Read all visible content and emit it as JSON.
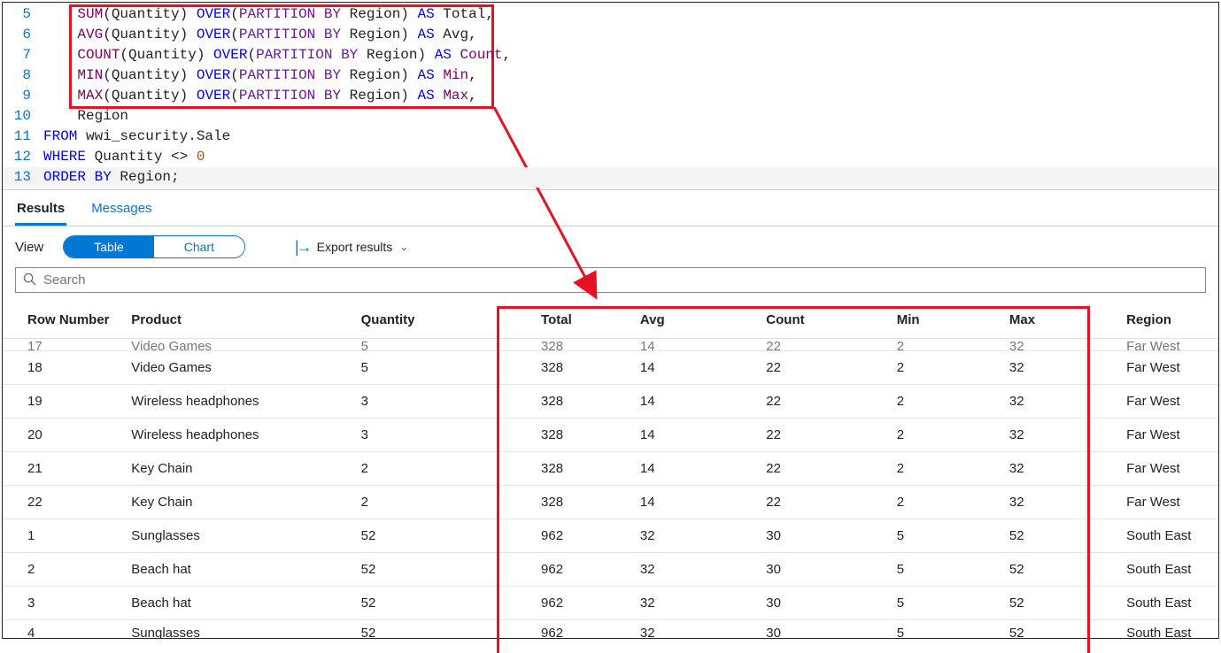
{
  "editor": {
    "lines": [
      {
        "n": 5,
        "tokens": [
          [
            "fn",
            "SUM"
          ],
          [
            "id",
            "(Quantity) "
          ],
          [
            "kw",
            "OVER"
          ],
          [
            "id",
            "("
          ],
          [
            "pkw",
            "PARTITION BY"
          ],
          [
            "id",
            " Region) "
          ],
          [
            "kw",
            "AS"
          ],
          [
            "id",
            " Total,"
          ]
        ]
      },
      {
        "n": 6,
        "tokens": [
          [
            "fn",
            "AVG"
          ],
          [
            "id",
            "(Quantity) "
          ],
          [
            "kw",
            "OVER"
          ],
          [
            "id",
            "("
          ],
          [
            "pkw",
            "PARTITION BY"
          ],
          [
            "id",
            " Region) "
          ],
          [
            "kw",
            "AS"
          ],
          [
            "id",
            " Avg,"
          ]
        ]
      },
      {
        "n": 7,
        "tokens": [
          [
            "fn",
            "COUNT"
          ],
          [
            "id",
            "(Quantity) "
          ],
          [
            "kw",
            "OVER"
          ],
          [
            "id",
            "("
          ],
          [
            "pkw",
            "PARTITION BY"
          ],
          [
            "id",
            " Region) "
          ],
          [
            "kw",
            "AS"
          ],
          [
            "id",
            " "
          ],
          [
            "fn",
            "Count"
          ],
          [
            "id",
            ","
          ]
        ]
      },
      {
        "n": 8,
        "tokens": [
          [
            "fn",
            "MIN"
          ],
          [
            "id",
            "(Quantity) "
          ],
          [
            "kw",
            "OVER"
          ],
          [
            "id",
            "("
          ],
          [
            "pkw",
            "PARTITION BY"
          ],
          [
            "id",
            " Region) "
          ],
          [
            "kw",
            "AS"
          ],
          [
            "id",
            " "
          ],
          [
            "fn",
            "Min"
          ],
          [
            "id",
            ","
          ]
        ]
      },
      {
        "n": 9,
        "tokens": [
          [
            "fn",
            "MAX"
          ],
          [
            "id",
            "(Quantity) "
          ],
          [
            "kw",
            "OVER"
          ],
          [
            "id",
            "("
          ],
          [
            "pkw",
            "PARTITION BY"
          ],
          [
            "id",
            " Region) "
          ],
          [
            "kw",
            "AS"
          ],
          [
            "id",
            " "
          ],
          [
            "fn",
            "Max"
          ],
          [
            "id",
            ","
          ]
        ]
      },
      {
        "n": 10,
        "tokens": [
          [
            "id",
            "Region"
          ]
        ]
      },
      {
        "n": 11,
        "tokens": [
          [
            "kw",
            "FROM"
          ],
          [
            "id",
            " wwi_security.Sale"
          ]
        ]
      },
      {
        "n": 12,
        "tokens": [
          [
            "kw",
            "WHERE"
          ],
          [
            "id",
            " Quantity <> "
          ],
          [
            "num",
            "0"
          ]
        ]
      },
      {
        "n": 13,
        "hl": true,
        "tokens": [
          [
            "kw",
            "ORDER BY"
          ],
          [
            "id",
            " Region;"
          ]
        ]
      }
    ]
  },
  "tabs": {
    "results": "Results",
    "messages": "Messages"
  },
  "toolbar": {
    "view": "View",
    "table": "Table",
    "chart": "Chart",
    "export": "Export results"
  },
  "search_placeholder": "Search",
  "columns": [
    "Row Number",
    "Product",
    "Quantity",
    "Total",
    "Avg",
    "Count",
    "Min",
    "Max",
    "Region"
  ],
  "rows": [
    {
      "clip": "top",
      "cells": [
        "17",
        "Video Games",
        "5",
        "328",
        "14",
        "22",
        "2",
        "32",
        "Far West"
      ]
    },
    {
      "cells": [
        "18",
        "Video Games",
        "5",
        "328",
        "14",
        "22",
        "2",
        "32",
        "Far West"
      ]
    },
    {
      "cells": [
        "19",
        "Wireless headphones",
        "3",
        "328",
        "14",
        "22",
        "2",
        "32",
        "Far West"
      ]
    },
    {
      "cells": [
        "20",
        "Wireless headphones",
        "3",
        "328",
        "14",
        "22",
        "2",
        "32",
        "Far West"
      ]
    },
    {
      "cells": [
        "21",
        "Key Chain",
        "2",
        "328",
        "14",
        "22",
        "2",
        "32",
        "Far West"
      ]
    },
    {
      "cells": [
        "22",
        "Key Chain",
        "2",
        "328",
        "14",
        "22",
        "2",
        "32",
        "Far West"
      ]
    },
    {
      "cells": [
        "1",
        "Sunglasses",
        "52",
        "962",
        "32",
        "30",
        "5",
        "52",
        "South East"
      ]
    },
    {
      "cells": [
        "2",
        "Beach hat",
        "52",
        "962",
        "32",
        "30",
        "5",
        "52",
        "South East"
      ]
    },
    {
      "cells": [
        "3",
        "Beach hat",
        "52",
        "962",
        "32",
        "30",
        "5",
        "52",
        "South East"
      ]
    },
    {
      "clip": "bot",
      "cells": [
        "4",
        "Sunglasses",
        "52",
        "962",
        "32",
        "30",
        "5",
        "52",
        "South East"
      ]
    }
  ]
}
